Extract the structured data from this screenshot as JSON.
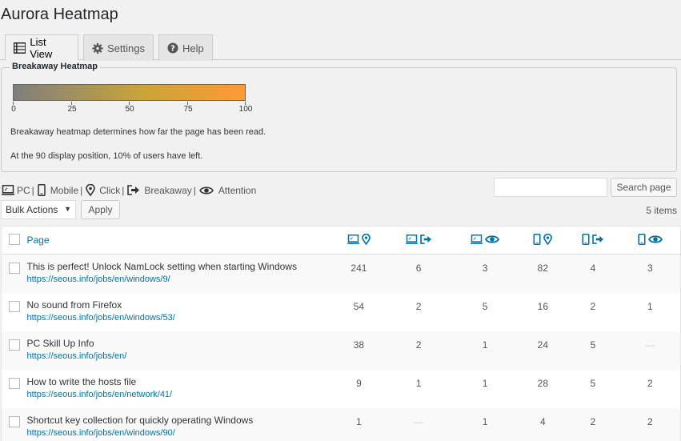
{
  "app_title": "Aurora Heatmap",
  "tabs": [
    {
      "label": "List View",
      "icon": "list-icon",
      "active": true
    },
    {
      "label": "Settings",
      "icon": "gear-icon",
      "active": false
    },
    {
      "label": "Help",
      "icon": "help-icon",
      "active": false
    }
  ],
  "heatmap_box": {
    "legend": "Breakaway Heatmap",
    "scale_labels": [
      "0",
      "25",
      "50",
      "75",
      "100"
    ],
    "description": "Breakaway heatmap determines how far the page has been read.",
    "note": "At the 90 display position, 10% of users have left."
  },
  "icon_legend": {
    "pc": "PC",
    "mobile": "Mobile",
    "click": "Click",
    "breakaway": "Breakaway",
    "attention": "Attention",
    "separator": "|"
  },
  "search": {
    "placeholder": "",
    "button_label": "Search page"
  },
  "bulk": {
    "selected": "Bulk Actions",
    "apply_label": "Apply"
  },
  "items_count": "5 items",
  "table": {
    "page_header": "Page",
    "column_icons": [
      [
        "pc-icon",
        "click-icon"
      ],
      [
        "pc-icon",
        "breakaway-icon"
      ],
      [
        "pc-icon",
        "attention-icon"
      ],
      [
        "mobile-icon",
        "click-icon"
      ],
      [
        "mobile-icon",
        "breakaway-icon"
      ],
      [
        "mobile-icon",
        "attention-icon"
      ]
    ],
    "rows": [
      {
        "title": "This is perfect! Unlock NamLock setting when starting Windows",
        "url": "https://seous.info/jobs/en/windows/9/",
        "values": [
          "241",
          "6",
          "3",
          "82",
          "4",
          "3"
        ]
      },
      {
        "title": "No sound from Firefox",
        "url": "https://seous.info/jobs/en/windows/53/",
        "values": [
          "54",
          "2",
          "5",
          "16",
          "2",
          "1"
        ]
      },
      {
        "title": "PC Skill Up Info",
        "url": "https://seous.info/jobs/en/",
        "values": [
          "38",
          "2",
          "1",
          "24",
          "5",
          "—"
        ]
      },
      {
        "title": "How to write the hosts file",
        "url": "https://seous.info/jobs/en/network/41/",
        "values": [
          "9",
          "1",
          "1",
          "28",
          "5",
          "2"
        ]
      },
      {
        "title": "Shortcut key collection for quickly operating Windows",
        "url": "https://seous.info/jobs/en/windows/90/",
        "values": [
          "1",
          "—",
          "1",
          "4",
          "2",
          "2"
        ]
      }
    ]
  },
  "colors": {
    "link": "#0073aa",
    "gradient_start": "#7e7e7e",
    "gradient_end": "#ff9a33"
  }
}
